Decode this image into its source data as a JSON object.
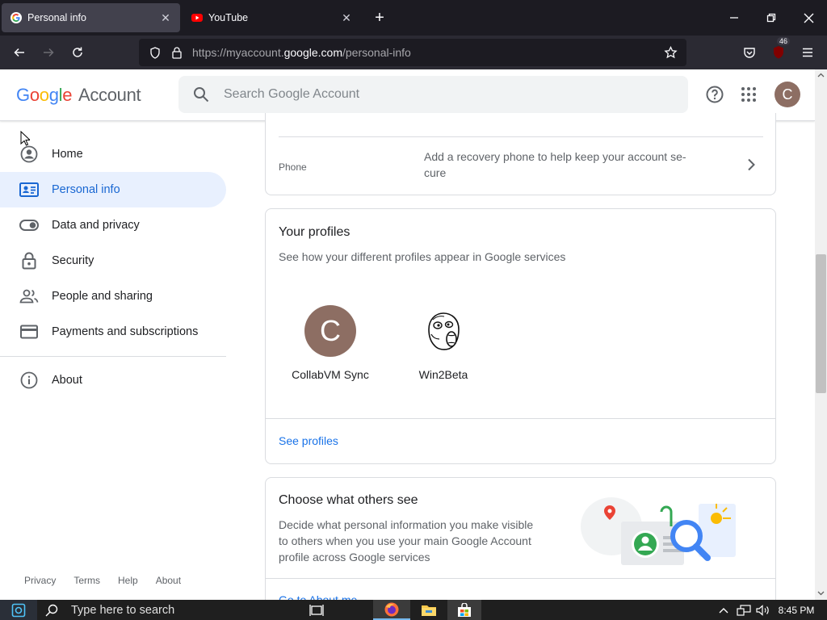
{
  "browser": {
    "tabs": [
      {
        "title": "Personal info",
        "favicon": "google-g-icon"
      },
      {
        "title": "YouTube",
        "favicon": "youtube-icon"
      }
    ],
    "url": {
      "prefix": "https://myaccount.",
      "host": "google.com",
      "path": "/personal-info"
    },
    "extension_badge": "46"
  },
  "header": {
    "logo_google": "Google",
    "logo_account": "Account",
    "search_placeholder": "Search Google Account",
    "avatar_letter": "C"
  },
  "sidebar": {
    "items": [
      {
        "label": "Home",
        "icon": "home-icon"
      },
      {
        "label": "Personal info",
        "icon": "id-card-icon"
      },
      {
        "label": "Data and privacy",
        "icon": "toggle-icon"
      },
      {
        "label": "Security",
        "icon": "lock-icon"
      },
      {
        "label": "People and sharing",
        "icon": "people-icon"
      },
      {
        "label": "Payments and subscriptions",
        "icon": "credit-card-icon"
      },
      {
        "label": "About",
        "icon": "info-icon"
      }
    ],
    "footer": [
      "Privacy",
      "Terms",
      "Help",
      "About"
    ]
  },
  "phone": {
    "label": "Phone",
    "value_line1": "Add a recovery phone to help keep your account se-",
    "value_line2": "cure"
  },
  "profiles": {
    "title": "Your profiles",
    "subtitle": "See how your different profiles appear in Google services",
    "items": [
      {
        "name": "CollabVM Sync",
        "letter": "C"
      },
      {
        "name": "Win2Beta",
        "letter": ""
      }
    ],
    "link": "See profiles"
  },
  "others": {
    "title": "Choose what others see",
    "desc_line1": "Decide what personal information you make visible",
    "desc_line2": "to others when you use your main Google Account",
    "desc_line3": "profile across Google services",
    "link_partial": "Go to About me"
  },
  "taskbar": {
    "search_placeholder": "Type here to search",
    "time": "8:45 PM"
  },
  "colors": {
    "accent": "#1a73e8",
    "avatar": "#8d6e63",
    "active_bg": "#e8f0fe"
  }
}
